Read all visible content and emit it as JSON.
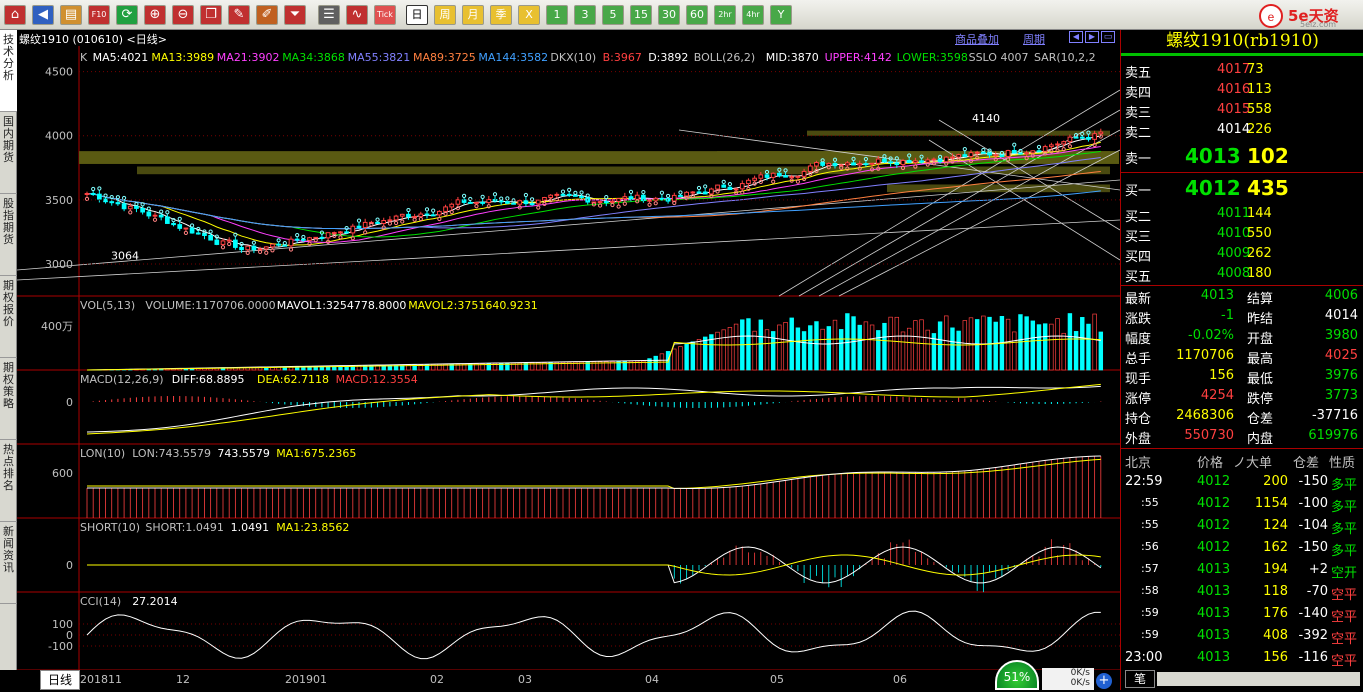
{
  "toolbar": {
    "buttons": [
      {
        "icon": "home-icon",
        "label": ""
      },
      {
        "icon": "back-icon",
        "label": ""
      },
      {
        "icon": "book-icon",
        "label": ""
      },
      {
        "icon": "f10-icon",
        "label": "F10"
      },
      {
        "icon": "refresh-icon",
        "label": ""
      },
      {
        "icon": "zoom-in-icon",
        "label": ""
      },
      {
        "icon": "zoom-out-icon",
        "label": ""
      },
      {
        "icon": "windows-icon",
        "label": ""
      },
      {
        "icon": "draw-icon",
        "label": ""
      },
      {
        "icon": "pen-icon",
        "label": ""
      },
      {
        "icon": "funnel-icon",
        "label": ""
      },
      {
        "icon": "list-icon",
        "label": ""
      },
      {
        "icon": "line-chart-icon",
        "label": ""
      },
      {
        "icon": "tick-icon",
        "label": "Tick"
      }
    ],
    "periods": [
      "日",
      "周",
      "月",
      "季",
      "Ⅹ",
      "1",
      "3",
      "5",
      "15",
      "30",
      "60",
      "2hr",
      "4hr",
      "Y"
    ],
    "active_period": "日"
  },
  "logo": {
    "text": "5e天资",
    "sub": "5eiz.com"
  },
  "sidetabs": [
    "技术分析",
    "国内期货",
    "股指期货",
    "期权报价",
    "期权策略",
    "热点排名",
    "新闻资讯"
  ],
  "chart": {
    "title": "螺纹1910 (010610) <日线>",
    "links": [
      "商品叠加",
      "周期"
    ],
    "main_legend": [
      {
        "t": "K",
        "c": "#c0c0c0"
      },
      {
        "t": "MA5:4021",
        "c": "#ffffff"
      },
      {
        "t": "MA13:3989",
        "c": "#ffff00"
      },
      {
        "t": "MA21:3902",
        "c": "#ff40ff"
      },
      {
        "t": "MA34:3868",
        "c": "#00e000"
      },
      {
        "t": "MA55:3821",
        "c": "#8080ff"
      },
      {
        "t": "MA89:3725",
        "c": "#ff8040"
      },
      {
        "t": "MA144:3582",
        "c": "#40a0ff"
      },
      {
        "t": "DKX(10)",
        "c": "#c0c0c0"
      },
      {
        "t": "B:3967",
        "c": "#ff4040"
      },
      {
        "t": "D:3892",
        "c": "#ffffff"
      },
      {
        "t": "BOLL(26,2)",
        "c": "#c0c0c0"
      },
      {
        "t": "MID:3870",
        "c": "#ffffff"
      },
      {
        "t": "UPPER:4142",
        "c": "#ff40ff"
      },
      {
        "t": "LOWER:3598",
        "c": "#00e000"
      },
      {
        "t": "SSLO 4007",
        "c": "#c0c0c0"
      },
      {
        "t": "SAR(10,2,2",
        "c": "#c0c0c0"
      }
    ],
    "y_ticks_main": [
      "4500",
      "4000",
      "3500",
      "3000"
    ],
    "annotations": {
      "low": "3064",
      "high": "4140"
    },
    "vol_legend": [
      {
        "t": "VOL(5,13)",
        "c": "#c0c0c0"
      },
      {
        "t": "VOLUME:1170706.0000",
        "c": "#c0c0c0"
      },
      {
        "t": "MAVOL1:3254778.8000",
        "c": "#ffffff"
      },
      {
        "t": "MAVOL2:3751640.9231",
        "c": "#ffff00"
      }
    ],
    "vol_tick": "400万",
    "macd_legend": [
      {
        "t": "MACD(12,26,9)",
        "c": "#c0c0c0"
      },
      {
        "t": "DIFF:68.8895",
        "c": "#ffffff"
      },
      {
        "t": "DEA:62.7118",
        "c": "#ffff00"
      },
      {
        "t": "MACD:12.3554",
        "c": "#ff4040"
      }
    ],
    "macd_tick": "0",
    "lon_legend": [
      {
        "t": "LON(10)",
        "c": "#c0c0c0"
      },
      {
        "t": "LON:743.5579",
        "c": "#c0c0c0"
      },
      {
        "t": "743.5579",
        "c": "#ffffff"
      },
      {
        "t": "MA1:675.2365",
        "c": "#ffff00"
      }
    ],
    "lon_tick": "600",
    "short_legend": [
      {
        "t": "SHORT(10)",
        "c": "#c0c0c0"
      },
      {
        "t": "SHORT:1.0491",
        "c": "#c0c0c0"
      },
      {
        "t": "1.0491",
        "c": "#ffffff"
      },
      {
        "t": "MA1:23.8562",
        "c": "#ffff00"
      }
    ],
    "short_tick": "0",
    "cci_legend": [
      {
        "t": "CCI(14)",
        "c": "#c0c0c0"
      },
      {
        "t": "27.2014",
        "c": "#ffffff"
      }
    ],
    "cci_ticks": [
      "100",
      "0",
      "-100"
    ],
    "x_labels": [
      "201811",
      "12",
      "201901",
      "02",
      "03",
      "04",
      "05",
      "06"
    ],
    "period_tab": "日线"
  },
  "quote": {
    "title": "螺纹1910(rb1910)",
    "asks": [
      {
        "name": "卖五",
        "price": "4017",
        "vol": "73",
        "pc": "red"
      },
      {
        "name": "卖四",
        "price": "4016",
        "vol": "113",
        "pc": "red"
      },
      {
        "name": "卖三",
        "price": "4015",
        "vol": "558",
        "pc": "red"
      },
      {
        "name": "卖二",
        "price": "4014",
        "vol": "226",
        "pc": "white"
      }
    ],
    "ask1": {
      "name": "卖一",
      "price": "4013",
      "vol": "102"
    },
    "bid1": {
      "name": "买一",
      "price": "4012",
      "vol": "435"
    },
    "bids": [
      {
        "name": "买二",
        "price": "4011",
        "vol": "144"
      },
      {
        "name": "买三",
        "price": "4010",
        "vol": "550"
      },
      {
        "name": "买四",
        "price": "4009",
        "vol": "262"
      },
      {
        "name": "买五",
        "price": "4008",
        "vol": "180"
      }
    ],
    "stats": [
      {
        "l1": "最新",
        "v1": "4013",
        "c1": "green",
        "l2": "结算",
        "v2": "4006",
        "c2": "green"
      },
      {
        "l1": "涨跌",
        "v1": "-1",
        "c1": "green",
        "l2": "昨结",
        "v2": "4014",
        "c2": "white"
      },
      {
        "l1": "幅度",
        "v1": "-0.02%",
        "c1": "green",
        "l2": "开盘",
        "v2": "3980",
        "c2": "green"
      },
      {
        "l1": "总手",
        "v1": "1170706",
        "c1": "yellow",
        "l2": "最高",
        "v2": "4025",
        "c2": "red"
      },
      {
        "l1": "现手",
        "v1": "156",
        "c1": "yellow",
        "l2": "最低",
        "v2": "3976",
        "c2": "green"
      },
      {
        "l1": "涨停",
        "v1": "4254",
        "c1": "red",
        "l2": "跌停",
        "v2": "3773",
        "c2": "green"
      },
      {
        "l1": "持仓",
        "v1": "2468306",
        "c1": "yellow",
        "l2": "仓差",
        "v2": "-37716",
        "c2": "white"
      },
      {
        "l1": "外盘",
        "v1": "550730",
        "c1": "red",
        "l2": "内盘",
        "v2": "619976",
        "c2": "green"
      }
    ],
    "tick_header": {
      "c1": "北京",
      "c2": "价格",
      "c3": "ノ大单",
      "c4": "仓差",
      "c5": "性质"
    },
    "ticks": [
      {
        "time": "22:59",
        "price": "4012",
        "vol": "200",
        "oi": "-150",
        "nature": "多平",
        "nc": "green"
      },
      {
        "time": ":55",
        "price": "4012",
        "vol": "1154",
        "oi": "-100",
        "nature": "多平",
        "nc": "green"
      },
      {
        "time": ":55",
        "price": "4012",
        "vol": "124",
        "oi": "-104",
        "nature": "多平",
        "nc": "green"
      },
      {
        "time": ":56",
        "price": "4012",
        "vol": "162",
        "oi": "-150",
        "nature": "多平",
        "nc": "green"
      },
      {
        "time": ":57",
        "price": "4013",
        "vol": "194",
        "oi": "+2",
        "nature": "空开",
        "nc": "green"
      },
      {
        "time": ":58",
        "price": "4013",
        "vol": "118",
        "oi": "-70",
        "nature": "空平",
        "nc": "red"
      },
      {
        "time": ":59",
        "price": "4013",
        "vol": "176",
        "oi": "-140",
        "nature": "空平",
        "nc": "red"
      },
      {
        "time": ":59",
        "price": "4013",
        "vol": "408",
        "oi": "-392",
        "nature": "空平",
        "nc": "red"
      },
      {
        "time": "23:00",
        "price": "4013",
        "vol": "156",
        "oi": "-116",
        "nature": "空平",
        "nc": "red"
      }
    ],
    "bottom_tab": "笔"
  },
  "status": {
    "pct": "51%",
    "net": "0K/s",
    "net2": "0K/s"
  }
}
